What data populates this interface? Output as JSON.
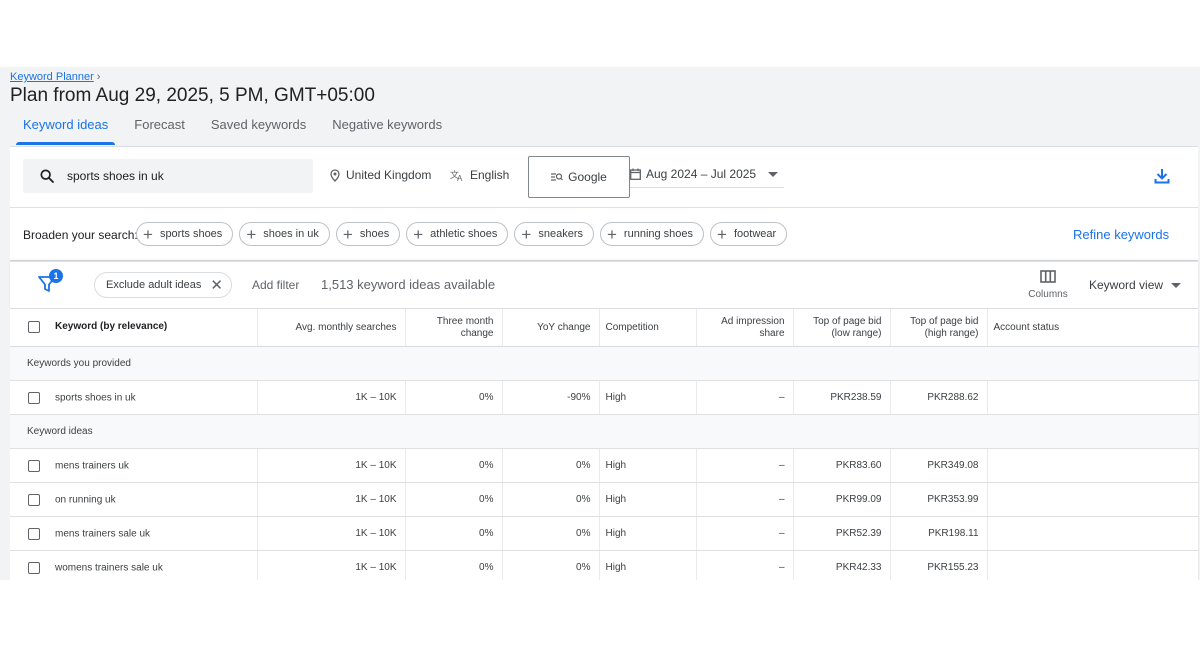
{
  "breadcrumb": {
    "link": "Keyword Planner"
  },
  "page_title": "Plan from Aug 29, 2025, 5 PM, GMT+05:00",
  "tabs": [
    {
      "label": "Keyword ideas"
    },
    {
      "label": "Forecast"
    },
    {
      "label": "Saved keywords"
    },
    {
      "label": "Negative keywords"
    }
  ],
  "search": {
    "query": "sports shoes in uk",
    "location": "United Kingdom",
    "language": "English",
    "network": "Google",
    "date_range": "Aug 2024 – Jul 2025"
  },
  "broaden": {
    "label": "Broaden your search:",
    "chips": [
      "sports shoes",
      "shoes in uk",
      "shoes",
      "athletic shoes",
      "sneakers",
      "running shoes",
      "footwear"
    ],
    "refine_label": "Refine keywords"
  },
  "filters": {
    "badge_count": "1",
    "adult_chip": "Exclude adult ideas",
    "add_filter": "Add filter",
    "count_text": "1,513 keyword ideas available",
    "columns_label": "Columns",
    "view_label": "Keyword view"
  },
  "table": {
    "headers": {
      "keyword": "Keyword (by relevance)",
      "avg_searches": "Avg. monthly searches",
      "three_month": [
        "Three month",
        "change"
      ],
      "yoy": "YoY change",
      "competition": "Competition",
      "ad_impression": [
        "Ad impression",
        "share"
      ],
      "bid_low": [
        "Top of page bid",
        "(low range)"
      ],
      "bid_high": [
        "Top of page bid",
        "(high range)"
      ],
      "account_status": "Account status"
    },
    "provided_section": "Keywords you provided",
    "provided_rows": [
      {
        "keyword": "sports shoes in uk",
        "avg": "1K – 10K",
        "three": "0%",
        "yoy": "-90%",
        "comp": "High",
        "ad": "–",
        "low": "PKR238.59",
        "high": "PKR288.62"
      }
    ],
    "ideas_section": "Keyword ideas",
    "ideas_rows": [
      {
        "keyword": "mens trainers uk",
        "avg": "1K – 10K",
        "three": "0%",
        "yoy": "0%",
        "comp": "High",
        "ad": "–",
        "low": "PKR83.60",
        "high": "PKR349.08"
      },
      {
        "keyword": "on running uk",
        "avg": "1K – 10K",
        "three": "0%",
        "yoy": "0%",
        "comp": "High",
        "ad": "–",
        "low": "PKR99.09",
        "high": "PKR353.99"
      },
      {
        "keyword": "mens trainers sale uk",
        "avg": "1K – 10K",
        "three": "0%",
        "yoy": "0%",
        "comp": "High",
        "ad": "–",
        "low": "PKR52.39",
        "high": "PKR198.11"
      },
      {
        "keyword": "womens trainers sale uk",
        "avg": "1K – 10K",
        "three": "0%",
        "yoy": "0%",
        "comp": "High",
        "ad": "–",
        "low": "PKR42.33",
        "high": "PKR155.23"
      }
    ]
  },
  "colors": {
    "accent": "#1a73e8",
    "background": "#f1f3f4"
  }
}
